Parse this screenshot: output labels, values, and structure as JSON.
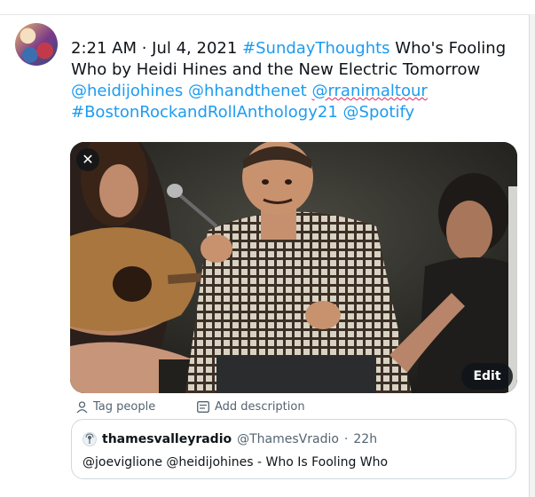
{
  "tweet": {
    "timestamp": "2:21 AM · Jul 4, 2021",
    "hashtag_1": "#SundayThoughts",
    "text_1": "Who's Fooling Who by Heidi Hines and the New Electric Tomorrow",
    "mention_1": "@heidijohines",
    "mention_2": "@hhandthenet",
    "mention_3": "@rranimaltour",
    "hashtag_2": "#BostonRockandRollAnthology21",
    "mention_4": "@Spotify"
  },
  "media": {
    "close_symbol": "✕",
    "edit_label": "Edit",
    "tag_people_label": "Tag people",
    "add_description_label": "Add description"
  },
  "quote": {
    "name": "thamesvalleyradio",
    "handle": "@ThamesVradio",
    "separator": "·",
    "time": "22h",
    "body": "@joeviglione @heidijohines - Who Is Fooling Who"
  },
  "colors": {
    "link": "#1d9bf0",
    "text": "#0f1419",
    "secondary": "#536471",
    "border": "#cfd9de"
  },
  "icons": [
    "close-icon",
    "person-icon",
    "description-icon",
    "radio-avatar-icon"
  ]
}
